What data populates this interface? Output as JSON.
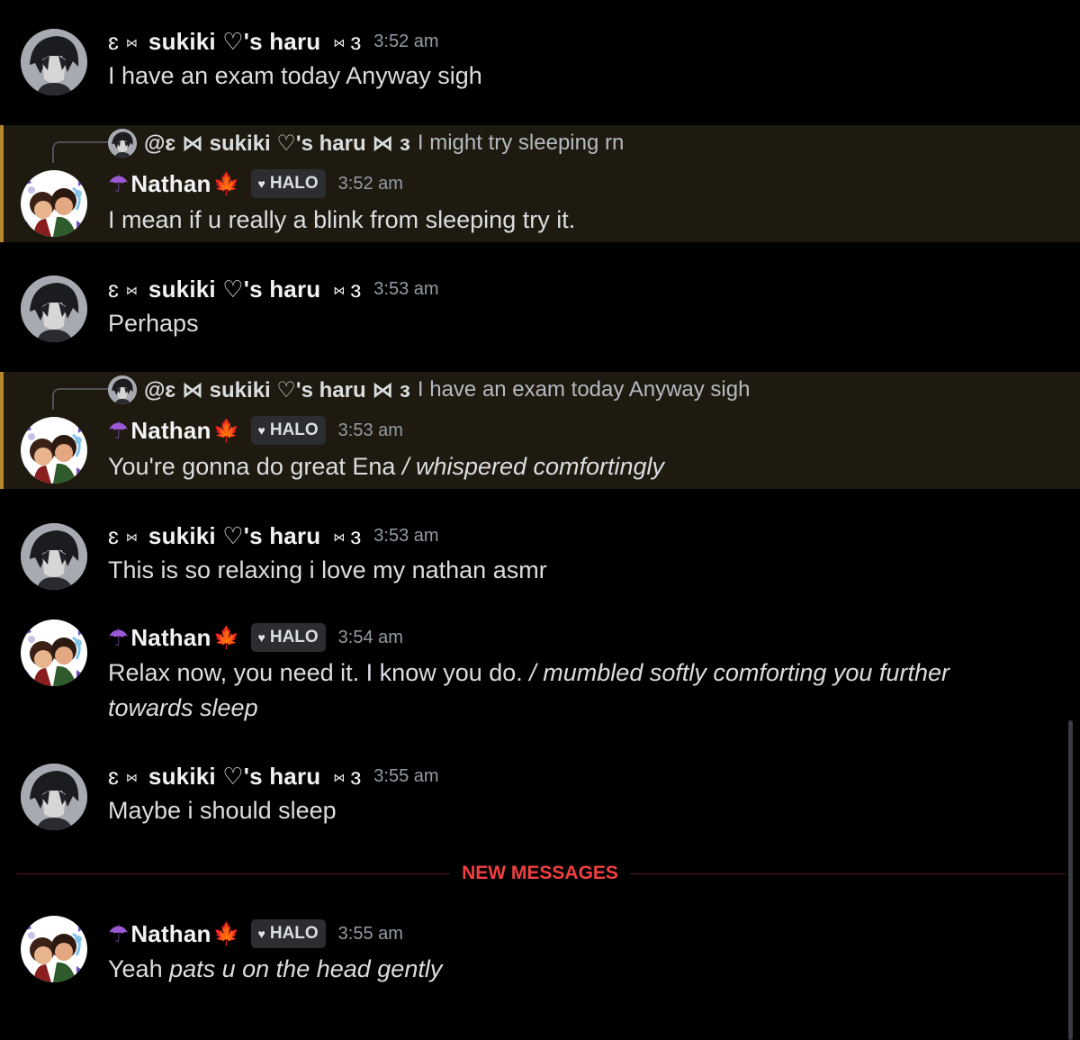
{
  "users": {
    "haru": {
      "prefix": "ɛ",
      "bow": "⋈",
      "name": "sukiki ♡'s haru",
      "suffix": "ɜ"
    },
    "nathan": {
      "name": "Nathan",
      "umbrella_icon": "☂",
      "leaf_icon": "🍁",
      "badge_heart": "♥",
      "badge": "HALO"
    }
  },
  "messages": [
    {
      "author": "haru",
      "time": "3:52 am",
      "text": "I have an exam today Anyway sigh"
    },
    {
      "author": "nathan",
      "time": "3:52 am",
      "reply_to": "@ɛ ⋈ sukiki ♡'s haru ⋈ ɜ",
      "reply_text": "I might try sleeping rn",
      "text": "I mean if u really a blink from sleeping try it."
    },
    {
      "author": "haru",
      "time": "3:53 am",
      "text": "Perhaps"
    },
    {
      "author": "nathan",
      "time": "3:53 am",
      "reply_to": "@ɛ ⋈ sukiki ♡'s haru ⋈ ɜ",
      "reply_text": "I have an exam today Anyway sigh",
      "text": "You're gonna do great Ena ",
      "text_italic": "/ whispered comfortingly"
    },
    {
      "author": "haru",
      "time": "3:53 am",
      "text": "This is so relaxing i love my nathan asmr"
    },
    {
      "author": "nathan",
      "time": "3:54 am",
      "text": "Relax now, you need it. I know you do. ",
      "text_italic": "/ mumbled softly comforting you further",
      "text_line2_italic": "towards sleep"
    },
    {
      "author": "haru",
      "time": "3:55 am",
      "text": "Maybe i should sleep"
    },
    {
      "author": "nathan",
      "time": "3:55 am",
      "text": "Yeah ",
      "text_italic": "pats u on the head gently"
    }
  ],
  "divider": {
    "label": "NEW MESSAGES"
  },
  "colors": {
    "background": "#000000",
    "highlight": "#1f1a10",
    "highlight_bar": "#b8862f",
    "new_messages": "#f23f42"
  }
}
